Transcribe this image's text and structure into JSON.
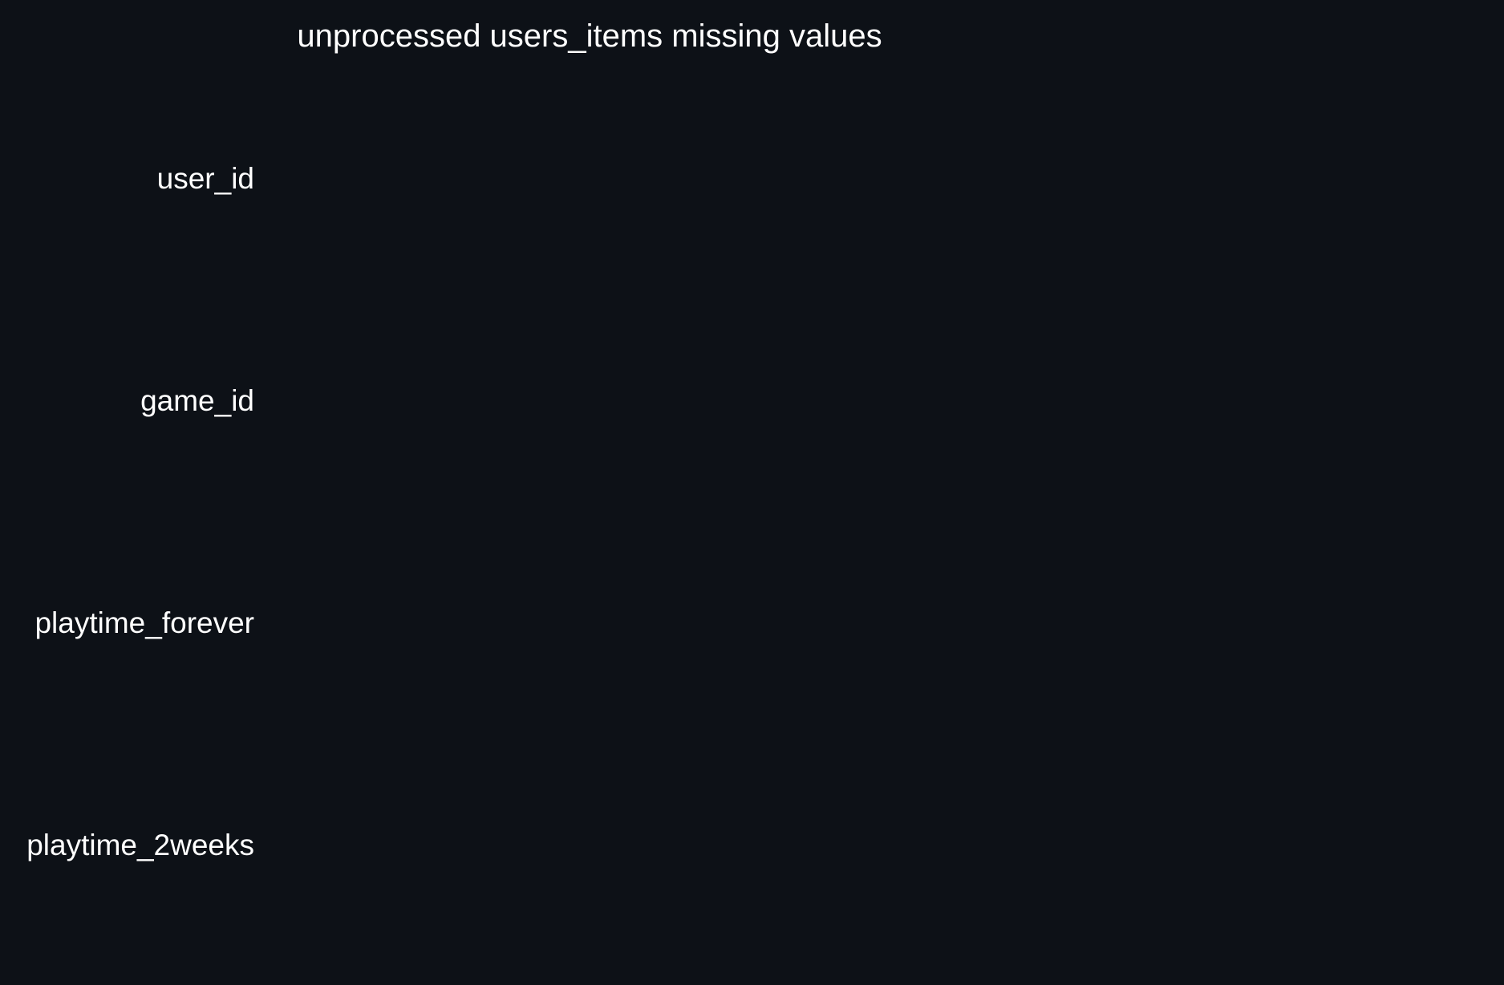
{
  "theme": {
    "background": "#0d1117",
    "text_color": "#ffffff"
  },
  "chart_data": {
    "type": "heatmap",
    "title": "unprocessed users_items missing values",
    "xlabel": "",
    "ylabel": "",
    "categories": [
      "user_id",
      "game_id",
      "playtime_forever",
      "playtime_2weeks"
    ],
    "missing_values": [],
    "grid": false,
    "legend": "none"
  }
}
